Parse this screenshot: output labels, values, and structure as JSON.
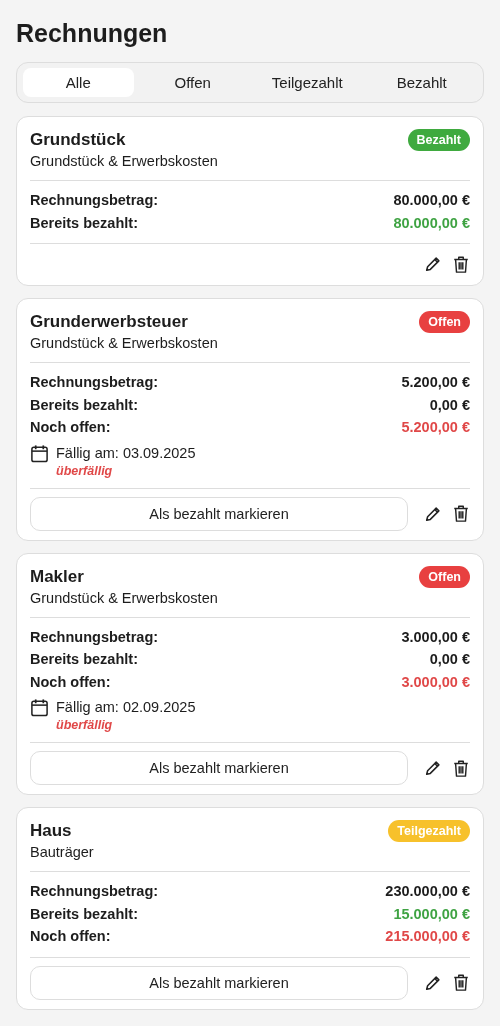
{
  "page_title": "Rechnungen",
  "tabs": [
    {
      "label": "Alle",
      "selected": true
    },
    {
      "label": "Offen",
      "selected": false
    },
    {
      "label": "Teilgezahlt",
      "selected": false
    },
    {
      "label": "Bezahlt",
      "selected": false
    }
  ],
  "invoices": [
    {
      "title": "Grundstück",
      "category": "Grundstück & Erwerbskosten",
      "status": {
        "label": "Bezahlt",
        "kind": "paid"
      },
      "amounts": [
        {
          "label": "Rechnungsbetrag:",
          "value": "80.000,00 €",
          "color": "#1d1d1d"
        },
        {
          "label": "Bereits bezahlt:",
          "value": "80.000,00 €",
          "color": "#3fa343"
        }
      ]
    },
    {
      "title": "Grunderwerbsteuer",
      "category": "Grundstück & Erwerbskosten",
      "status": {
        "label": "Offen",
        "kind": "open"
      },
      "amounts": [
        {
          "label": "Rechnungsbetrag:",
          "value": "5.200,00 €",
          "color": "#1d1d1d"
        },
        {
          "label": "Bereits bezahlt:",
          "value": "0,00 €",
          "color": "#1d1d1d"
        },
        {
          "label": "Noch offen:",
          "value": "5.200,00 €",
          "color": "#e04848"
        }
      ],
      "due": {
        "label": "Fällig am: 03.09.2025",
        "note": "überfällig"
      },
      "mark_button": "Als bezahlt markieren"
    },
    {
      "title": "Makler",
      "category": "Grundstück & Erwerbskosten",
      "status": {
        "label": "Offen",
        "kind": "open"
      },
      "amounts": [
        {
          "label": "Rechnungsbetrag:",
          "value": "3.000,00 €",
          "color": "#1d1d1d"
        },
        {
          "label": "Bereits bezahlt:",
          "value": "0,00 €",
          "color": "#1d1d1d"
        },
        {
          "label": "Noch offen:",
          "value": "3.000,00 €",
          "color": "#e04848"
        }
      ],
      "due": {
        "label": "Fällig am: 02.09.2025",
        "note": "überfällig"
      },
      "mark_button": "Als bezahlt markieren"
    },
    {
      "title": "Haus",
      "category": "Bauträger",
      "status": {
        "label": "Teilgezahlt",
        "kind": "partial"
      },
      "amounts": [
        {
          "label": "Rechnungsbetrag:",
          "value": "230.000,00 €",
          "color": "#1d1d1d"
        },
        {
          "label": "Bereits bezahlt:",
          "value": "15.000,00 €",
          "color": "#3fa343"
        },
        {
          "label": "Noch offen:",
          "value": "215.000,00 €",
          "color": "#e04848"
        }
      ],
      "mark_button": "Als bezahlt markieren"
    }
  ]
}
